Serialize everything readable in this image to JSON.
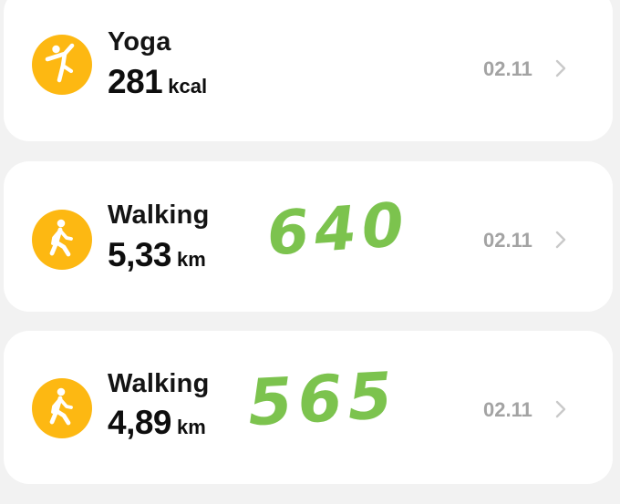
{
  "activities": [
    {
      "name": "Yoga",
      "value": "281",
      "unit": "kcal",
      "date": "02.11",
      "icon": "yoga-icon",
      "note": ""
    },
    {
      "name": "Walking",
      "value": "5,33",
      "unit": "km",
      "date": "02.11",
      "icon": "walking-icon",
      "note": "640"
    },
    {
      "name": "Walking",
      "value": "4,89",
      "unit": "km",
      "date": "02.11",
      "icon": "walking-icon",
      "note": "565"
    }
  ],
  "colors": {
    "icon_background": "#fdb812",
    "handwriting": "#7cc34e",
    "date_text": "#a3a3a3",
    "card_background": "#ffffff",
    "page_background": "#f2f2f2"
  }
}
